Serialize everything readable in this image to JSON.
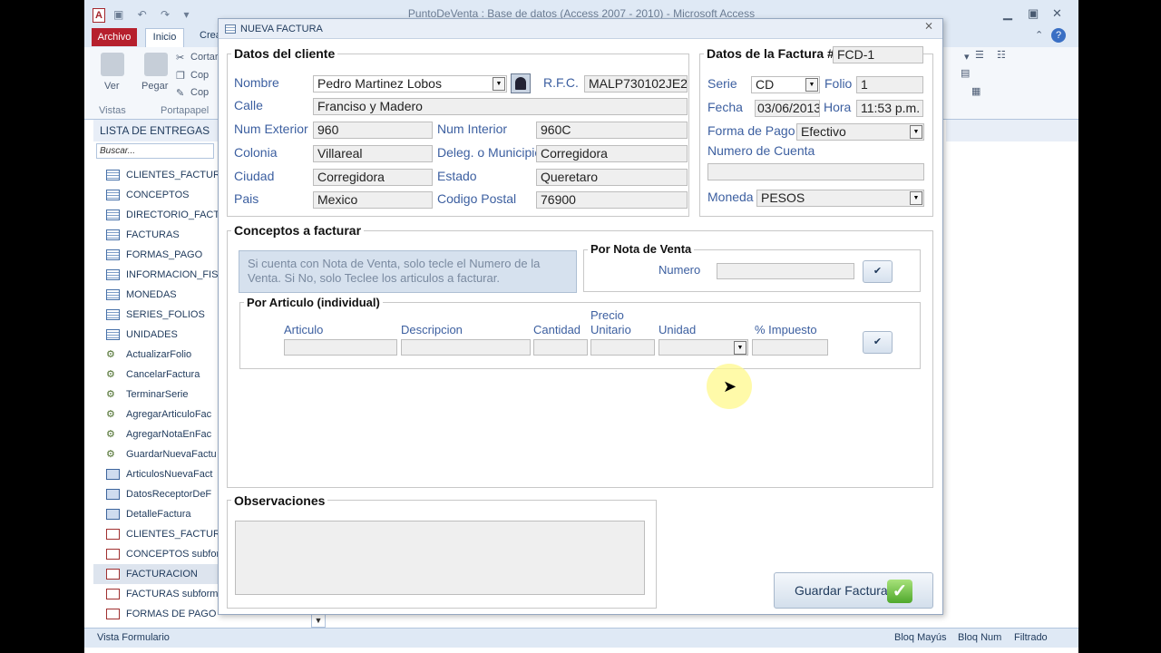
{
  "window": {
    "title": "PuntoDeVenta : Base de datos (Access 2007 - 2010) - Microsoft Access",
    "app_icon": "A"
  },
  "ribbon": {
    "tab_archivo": "Archivo",
    "tab_inicio": "Inicio",
    "tab_crear": "Crea",
    "ver_label": "Ver",
    "pegar_label": "Pegar",
    "cortar_label": "Cortar",
    "copiar_label": "Cop",
    "copiar_formato_label": "Cop",
    "group_vistas": "Vistas",
    "group_portapapeles": "Portapapel"
  },
  "nav": {
    "header": "LISTA DE ENTREGAS",
    "search_placeholder": "Buscar...",
    "items": [
      {
        "label": "CLIENTES_FACTURA",
        "kind": "table"
      },
      {
        "label": "CONCEPTOS",
        "kind": "table"
      },
      {
        "label": "DIRECTORIO_FACTU",
        "kind": "table"
      },
      {
        "label": "FACTURAS",
        "kind": "table"
      },
      {
        "label": "FORMAS_PAGO",
        "kind": "table"
      },
      {
        "label": "INFORMACION_FIS",
        "kind": "table"
      },
      {
        "label": "MONEDAS",
        "kind": "table"
      },
      {
        "label": "SERIES_FOLIOS",
        "kind": "table"
      },
      {
        "label": "UNIDADES",
        "kind": "table"
      },
      {
        "label": "ActualizarFolio",
        "kind": "query"
      },
      {
        "label": "CancelarFactura",
        "kind": "query"
      },
      {
        "label": "TerminarSerie",
        "kind": "query"
      },
      {
        "label": "AgregarArticuloFac",
        "kind": "query"
      },
      {
        "label": "AgregarNotaEnFac",
        "kind": "query"
      },
      {
        "label": "GuardarNuevaFactu",
        "kind": "query"
      },
      {
        "label": "ArticulosNuevaFact",
        "kind": "form"
      },
      {
        "label": "DatosReceptorDeF",
        "kind": "form"
      },
      {
        "label": "DetalleFactura",
        "kind": "form"
      },
      {
        "label": "CLIENTES_FACTURAS",
        "kind": "report"
      },
      {
        "label": "CONCEPTOS subform",
        "kind": "report"
      },
      {
        "label": "FACTURACION",
        "kind": "report",
        "selected": true
      },
      {
        "label": "FACTURAS subform",
        "kind": "report"
      },
      {
        "label": "FORMAS DE PAGO",
        "kind": "report"
      }
    ]
  },
  "status": {
    "left": "Vista Formulario",
    "bloq_mayus": "Bloq Mayús",
    "bloq_num": "Bloq Num",
    "filtrado": "Filtrado"
  },
  "dialog": {
    "title": "NUEVA FACTURA",
    "cliente": {
      "group_title": "Datos del cliente",
      "nombre_label": "Nombre",
      "nombre_value": "Pedro Martinez Lobos",
      "rfc_label": "R.F.C.",
      "rfc_value": "MALP730102JE2",
      "calle_label": "Calle",
      "calle_value": "Franciso y Madero",
      "num_ext_label": "Num Exterior",
      "num_ext_value": "960",
      "num_int_label": "Num Interior",
      "num_int_value": "960C",
      "colonia_label": "Colonia",
      "colonia_value": "Villareal",
      "deleg_label": "Deleg. o Municipio",
      "deleg_value": "Corregidora",
      "ciudad_label": "Ciudad",
      "ciudad_value": "Corregidora",
      "estado_label": "Estado",
      "estado_value": "Queretaro",
      "pais_label": "Pais",
      "pais_value": "Mexico",
      "cp_label": "Codigo Postal",
      "cp_value": "76900"
    },
    "factura": {
      "group_title": "Datos de la Factura #",
      "numero_value": "FCD-1",
      "serie_label": "Serie",
      "serie_value": "CD",
      "folio_label": "Folio",
      "folio_value": "1",
      "fecha_label": "Fecha",
      "fecha_value": "03/06/2013",
      "hora_label": "Hora",
      "hora_value": "11:53 p.m.",
      "forma_pago_label": "Forma de Pago",
      "forma_pago_value": "Efectivo",
      "num_cuenta_label": "Numero de Cuenta",
      "num_cuenta_value": "",
      "moneda_label": "Moneda",
      "moneda_value": "PESOS"
    },
    "conceptos": {
      "group_title": "Conceptos a facturar",
      "note": "Si cuenta con Nota de Venta, solo tecle el Numero de la Venta. Si No, solo Teclee los articulos a facturar.",
      "nota_group_title": "Por Nota de Venta",
      "numero_label": "Numero",
      "numero_value": "",
      "articulo_group_title": "Por Articulo (individual)",
      "col_articulo": "Articulo",
      "col_descripcion": "Descripcion",
      "col_cantidad": "Cantidad",
      "col_precio_1": "Precio",
      "col_precio_2": "Unitario",
      "col_unidad": "Unidad",
      "col_impuesto": "% Impuesto",
      "ok_glyph": "✔"
    },
    "observaciones": {
      "group_title": "Observaciones",
      "value": ""
    },
    "guardar_label": "Guardar Factura"
  }
}
